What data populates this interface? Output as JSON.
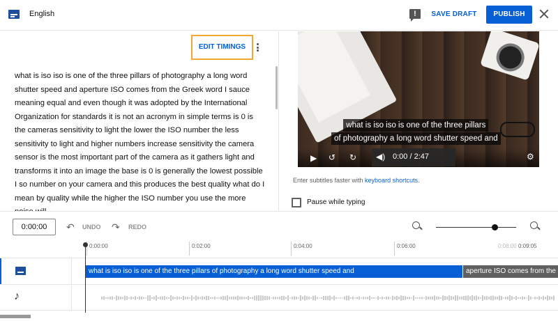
{
  "header": {
    "language": "English",
    "save_draft": "SAVE DRAFT",
    "publish": "PUBLISH",
    "feedback_icon": "feedback-icon",
    "close_icon": "close-icon"
  },
  "editor": {
    "edit_timings": "EDIT TIMINGS",
    "transcript": "what is iso iso is one of the three pillars of photography a long word shutter speed and aperture ISO comes from the Greek word I sauce meaning equal and even though it was adopted by the International Organization for standards it is not an acronym in simple terms is 0 is the cameras sensitivity to light the lower the ISO number the less sensitivity to light and higher numbers increase sensitivity the camera sensor is the most important part of the camera as it gathers light and transforms it into an image the base is 0 is generally the lowest possible I so number on your camera and this produces the best quality what do I mean by quality while the higher the ISO number you use the more noise will"
  },
  "video": {
    "subtitle_line1": "what is iso iso is one of the three pillars",
    "subtitle_line2": "of photography a long word shutter speed and",
    "time": "0:00 / 2:47"
  },
  "hint": {
    "prefix": "Enter subtitles faster with ",
    "link": "keyboard shortcuts",
    "suffix": "."
  },
  "pause_while_typing": "Pause while typing",
  "toolbar": {
    "time_value": "0:00:00",
    "undo": "UNDO",
    "redo": "REDO",
    "zoom_level": 0.72
  },
  "timeline": {
    "ticks": [
      "0:00:00",
      "0:02:00",
      "0:04:00",
      "0:06:00"
    ],
    "end_faded": "0:08:00",
    "end_label": "0:09:05",
    "cue1": "what is iso iso is one of the three pillars  of photography a long word shutter speed and",
    "cue2": "aperture ISO comes from the Greek word I sauce meaning equal"
  }
}
